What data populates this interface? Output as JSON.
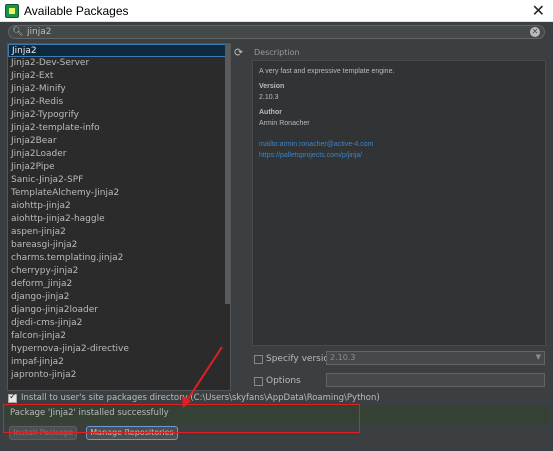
{
  "window": {
    "title": "Available Packages",
    "close_glyph": "✕"
  },
  "search": {
    "value": "jinja2"
  },
  "packages": [
    "Jinja2",
    "Jinja2-Dev-Server",
    "Jinja2-Ext",
    "Jinja2-Minify",
    "Jinja2-Redis",
    "Jinja2-Typogrify",
    "Jinja2-template-info",
    "Jinja2Bear",
    "Jinja2Loader",
    "Jinja2Pipe",
    "Sanic-Jinja2-SPF",
    "TemplateAlchemy-Jinja2",
    "aiohttp-jinja2",
    "aiohttp-jinja2-haggle",
    "aspen-jinja2",
    "bareasgi-jinja2",
    "charms.templating.jinja2",
    "cherrypy-jinja2",
    "deform_jinja2",
    "django-jinja2",
    "django-jinja2loader",
    "djedi-cms-jinja2",
    "falcon-jinja2",
    "hypernova-jinja2-directive",
    "impaf-jinja2",
    "japronto-jinja2"
  ],
  "selected_package": "Jinja2",
  "description": {
    "label": "Description",
    "summary": "A very fast and expressive template engine.",
    "version_heading": "Version",
    "version": "2.10.3",
    "author_heading": "Author",
    "author": "Armin Ronacher",
    "email": "mailto:armin.ronacher@active-4.com",
    "url": "https://palletsprojects.com/p/jinja/"
  },
  "options": {
    "specify_version_label": "Specify version",
    "specify_version_value": "2.10.3",
    "options_label": "Options"
  },
  "install_to_user": {
    "label": "Install to user's site packages directory (C:\\Users\\skyfans\\AppData\\Roaming\\Python)",
    "checked": true
  },
  "status": "Package 'Jinja2' installed successfully",
  "buttons": {
    "install": "Install Package",
    "manage": "Manage Repositories"
  },
  "icons": {
    "search": "search-icon",
    "clear": "clear-icon",
    "refresh": "refresh-icon",
    "chevron": "chevron-down-icon"
  },
  "colors": {
    "annotation": "#e02020",
    "selection": "#0d293e",
    "link": "#3f85c7",
    "status_bg": "#344134"
  }
}
